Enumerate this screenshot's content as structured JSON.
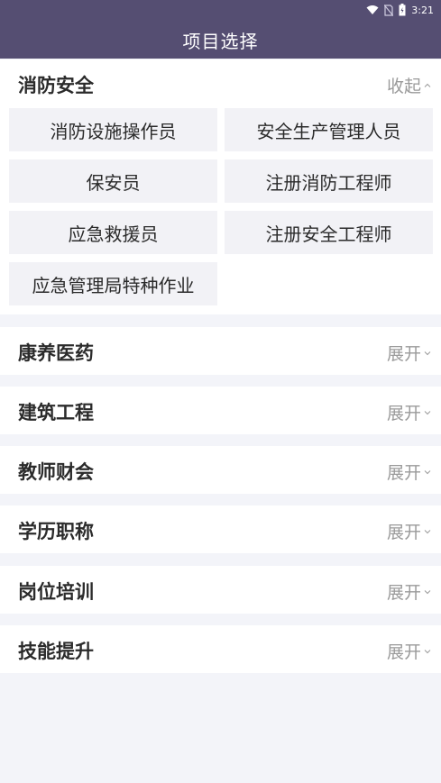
{
  "status_bar": {
    "time": "3:21"
  },
  "header": {
    "title": "项目选择"
  },
  "sections": [
    {
      "title": "消防安全",
      "toggle": "收起",
      "state": "expanded",
      "options": [
        "消防设施操作员",
        "安全生产管理人员",
        "保安员",
        "注册消防工程师",
        "应急救援员",
        "注册安全工程师",
        "应急管理局特种作业"
      ]
    },
    {
      "title": "康养医药",
      "toggle": "展开",
      "state": "collapsed"
    },
    {
      "title": "建筑工程",
      "toggle": "展开",
      "state": "collapsed"
    },
    {
      "title": "教师财会",
      "toggle": "展开",
      "state": "collapsed"
    },
    {
      "title": "学历职称",
      "toggle": "展开",
      "state": "collapsed"
    },
    {
      "title": "岗位培训",
      "toggle": "展开",
      "state": "collapsed"
    },
    {
      "title": "技能提升",
      "toggle": "展开",
      "state": "collapsed"
    }
  ],
  "colors": {
    "header_bg": "#554e72",
    "page_bg": "#f3f4f9",
    "option_bg": "#f2f2f6",
    "toggle_text": "#9a9a9a"
  },
  "icons": [
    "wifi-icon",
    "no-sim-icon",
    "battery-icon",
    "chevron-up-icon",
    "chevron-down-icon"
  ]
}
